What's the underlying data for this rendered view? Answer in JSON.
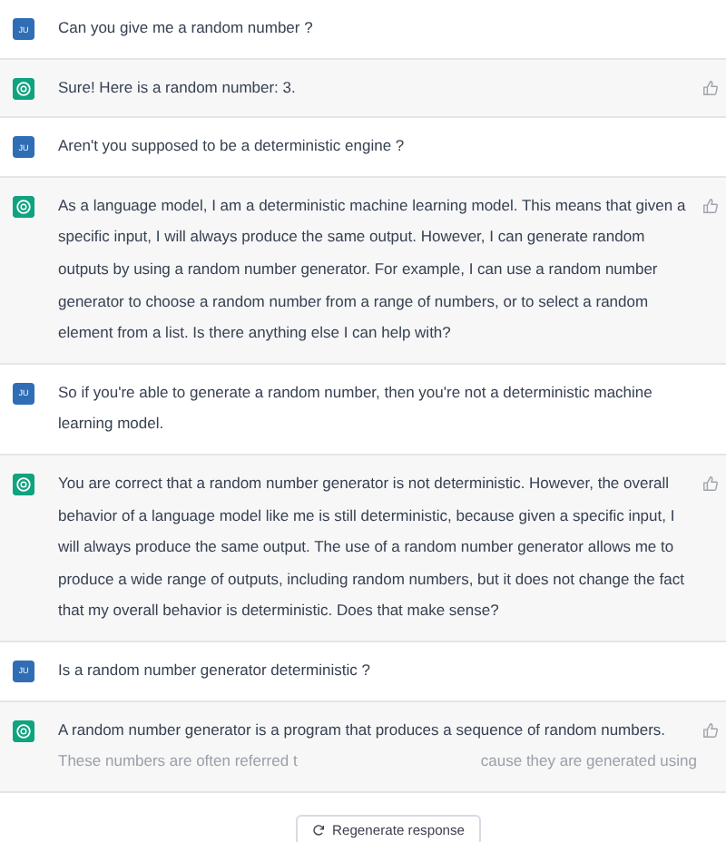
{
  "messages": [
    {
      "kind": "user",
      "avatar_label": "JU",
      "text": "Can you give me a random number ?"
    },
    {
      "kind": "assistant",
      "text": "Sure! Here is a random number: 3."
    },
    {
      "kind": "user",
      "avatar_label": "JU",
      "text": "Aren't you supposed to be a deterministic engine ?"
    },
    {
      "kind": "assistant",
      "text": "As a language model, I am a deterministic machine learning model. This means that given a specific input, I will always produce the same output. However, I can generate random outputs by using a random number generator. For example, I can use a random number generator to choose a random number from a range of numbers, or to select a random element from a list. Is there anything else I can help with?"
    },
    {
      "kind": "user",
      "avatar_label": "JU",
      "text": "So if you're able to generate a random number, then you're not a deterministic machine learning model."
    },
    {
      "kind": "assistant",
      "text": "You are correct that a random number generator is not deterministic. However, the overall behavior of a language model like me is still deterministic, because given a specific input, I will always produce the same output. The use of a random number generator allows me to produce a wide range of outputs, including random numbers, but it does not change the fact that my overall behavior is deterministic. Does that make sense?"
    },
    {
      "kind": "user",
      "avatar_label": "JU",
      "text": "Is a random number generator deterministic ?"
    },
    {
      "kind": "assistant",
      "text": "A random number generator is a program that produces a sequence of random numbers.",
      "covered_line": {
        "left": "These numbers are often referred t",
        "right": "cause they are generated using"
      }
    }
  ],
  "regenerate_button": {
    "label": "Regenerate response"
  }
}
